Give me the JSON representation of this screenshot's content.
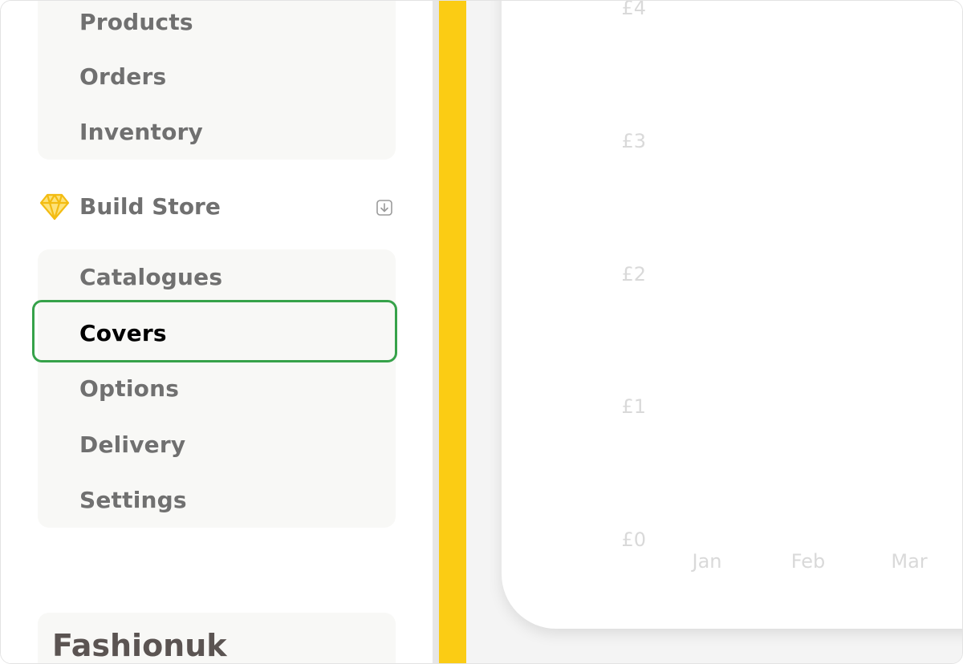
{
  "sidebar": {
    "orders_group": {
      "items": [
        {
          "label": "Products"
        },
        {
          "label": "Orders"
        },
        {
          "label": "Inventory"
        }
      ]
    },
    "build_store": {
      "title": "Build Store",
      "icon": "diamond-icon",
      "toggle_icon": "collapse-arrow-icon",
      "items": [
        {
          "label": "Catalogues"
        },
        {
          "label": "Covers",
          "active": true
        },
        {
          "label": "Options"
        },
        {
          "label": "Delivery"
        },
        {
          "label": "Settings"
        }
      ]
    },
    "store_name": "Fashionuk"
  },
  "colors": {
    "accent_yellow": "#fbcc14",
    "highlight_green": "#36a24a",
    "muted_text": "#707070",
    "active_text": "#000000"
  },
  "chart_data": {
    "type": "bar",
    "categories": [
      "Jan",
      "Feb",
      "Mar"
    ],
    "y_tick_labels": [
      "£4",
      "£3",
      "£2",
      "£1",
      "£0"
    ],
    "ylim": [
      0,
      4
    ],
    "values": [],
    "xlabel": "",
    "ylabel": ""
  }
}
